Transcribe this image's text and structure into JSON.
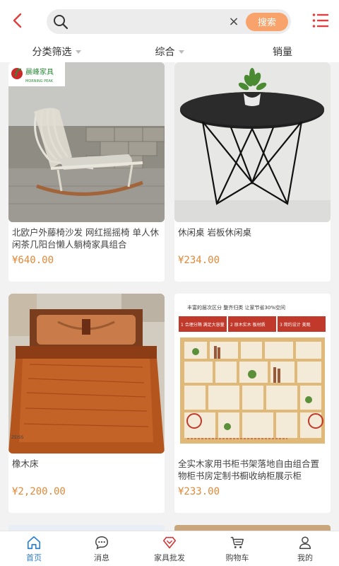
{
  "search": {
    "value": "",
    "button_label": "搜索"
  },
  "filters": [
    {
      "label": "分类筛选",
      "has_caret": true
    },
    {
      "label": "综合",
      "has_caret": true
    },
    {
      "label": "销量",
      "has_caret": false
    }
  ],
  "products": [
    {
      "title": "北欧户外藤椅沙发 网红摇摇椅 单人休闲茶几阳台懒人躺椅家具组合",
      "price": "¥640.00",
      "badge": "晨峰家具",
      "badge_sub": "MORNING PEAK"
    },
    {
      "title": "休闲桌 岩板休闲桌",
      "price": "¥234.00"
    },
    {
      "title": "橡木床",
      "price": "¥2,200.00"
    },
    {
      "title": "全实木家用书柜书架落地自由组合置物柜书房定制书橱收纳柜展示柜",
      "price": "¥233.00",
      "promo": {
        "top": "丰富的层次区分 整齐归类 让家节省30%空间",
        "p1": "1 合理分隔 满足大容量",
        "p2": "2 原木实木 板材质",
        "p3": "3 简约设计 美观"
      }
    }
  ],
  "tabs": [
    {
      "label": "首页",
      "icon": "home-icon",
      "active": true
    },
    {
      "label": "消息",
      "icon": "message-icon",
      "active": false
    },
    {
      "label": "家具批发",
      "icon": "diamond-icon",
      "active": false
    },
    {
      "label": "购物车",
      "icon": "cart-icon",
      "active": false
    },
    {
      "label": "我的",
      "icon": "user-icon",
      "active": false
    }
  ],
  "colors": {
    "accent": "#f7a36b",
    "price": "#e08a3a",
    "back": "#e04040",
    "tab_active": "#2b7fd1"
  }
}
